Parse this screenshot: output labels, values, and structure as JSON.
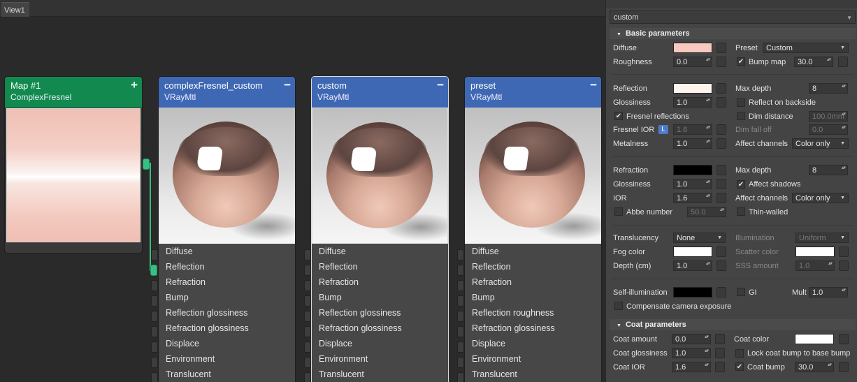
{
  "tabs": {
    "view1": "View1"
  },
  "nodes": {
    "map": {
      "title": "Map #1",
      "subtitle": "ComplexFresnel",
      "button": "+"
    },
    "cf": {
      "title": "complexFresnel_custom",
      "subtitle": "VRayMtl",
      "button": "−"
    },
    "custom": {
      "title": "custom",
      "subtitle": "VRayMtl",
      "button": "−"
    },
    "preset": {
      "title": "preset",
      "subtitle": "VRayMtl",
      "button": "−"
    }
  },
  "slots_cf": [
    "Diffuse",
    "Reflection",
    "Refraction",
    "Bump",
    "Reflection glossiness",
    "Refraction glossiness",
    "Displace",
    "Environment",
    "Translucent"
  ],
  "slots_custom": [
    "Diffuse",
    "Reflection",
    "Refraction",
    "Bump",
    "Reflection glossiness",
    "Refraction glossiness",
    "Displace",
    "Environment",
    "Translucent"
  ],
  "slots_preset": [
    "Diffuse",
    "Reflection",
    "Refraction",
    "Bump",
    "Reflection roughness",
    "Refraction glossiness",
    "Displace",
    "Environment",
    "Translucent"
  ],
  "colors": {
    "map_header": "#128a4f",
    "node_header": "#3f68b4",
    "link": "#37c083"
  },
  "panel": {
    "material_name": "custom",
    "basic": {
      "title": "Basic parameters",
      "diffuse": "Diffuse",
      "roughness": "Roughness",
      "roughness_val": "0.0",
      "preset": "Preset",
      "preset_val": "Custom",
      "bump_map": "Bump map",
      "bump_val": "30.0",
      "reflection": "Reflection",
      "max_depth": "Max depth",
      "max_depth_val": "8",
      "glossiness": "Glossiness",
      "gloss_val": "1.0",
      "reflect_backside": "Reflect on backside",
      "fresnel_reflections": "Fresnel reflections",
      "dim_distance": "Dim distance",
      "dim_distance_val": "100.0mm",
      "fresnel_ior": "Fresnel IOR",
      "l_badge": "L",
      "fresnel_ior_val": "1.6",
      "dim_falloff": "Dim fall off",
      "dim_falloff_val": "0.0",
      "metalness": "Metalness",
      "metal_val": "1.0",
      "affect_channels": "Affect channels",
      "affect_val": "Color only",
      "refraction": "Refraction",
      "r_max_depth": "Max depth",
      "r_max_depth_val": "8",
      "r_glossiness": "Glossiness",
      "r_gloss_val": "1.0",
      "affect_shadows": "Affect shadows",
      "ior": "IOR",
      "ior_val": "1.6",
      "r_affect_channels": "Affect channels",
      "r_affect_val": "Color only",
      "abbe": "Abbe number",
      "abbe_val": "50.0",
      "thin_walled": "Thin-walled",
      "translucency": "Translucency",
      "transl_val": "None",
      "illumination": "Illumination",
      "illum_val": "Uniform",
      "fog_color": "Fog color",
      "scatter_color": "Scatter color",
      "depth": "Depth (cm)",
      "depth_val": "1.0",
      "sss_amount": "SSS amount",
      "sss_val": "1.0",
      "self_illum": "Self-illumination",
      "gi": "GI",
      "mult": "Mult",
      "mult_val": "1.0",
      "compensate": "Compensate camera exposure"
    },
    "coat": {
      "title": "Coat parameters",
      "amount": "Coat amount",
      "amount_val": "0.0",
      "color": "Coat color",
      "gloss": "Coat glossiness",
      "gloss_val": "1.0",
      "lock": "Lock coat bump to base bump",
      "ior": "Coat IOR",
      "ior_val": "1.6",
      "bump": "Coat bump",
      "bump_val": "30.0"
    },
    "swatches": {
      "diffuse": "#f7c9c0",
      "reflection": "#fff3ee",
      "refraction": "#000000",
      "fog": "#ffffff",
      "scatter": "#ffffff",
      "self_illum": "#000000",
      "coat": "#ffffff"
    }
  }
}
